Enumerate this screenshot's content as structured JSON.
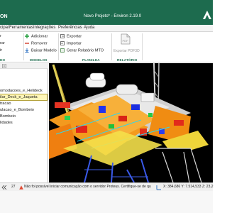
{
  "window": {
    "app_label": "ON",
    "title": "Novo Projeto* - Environ 2.19.0",
    "partial_title": "- Environ 2.19.0"
  },
  "menu": [
    "cipal",
    "Ferramentas",
    "Integrações",
    "Preferências",
    "Ajuda"
  ],
  "ribbon": {
    "modelos_buttons": [
      "Adicionar",
      "Remover",
      "Baixar Modelo"
    ],
    "planilha_buttons": [
      "Exportar",
      "Importar",
      "Gerar Relatório MTO"
    ],
    "relatorio_button": "Exportar PDF3D",
    "left_buttons": [
      "r",
      "rar",
      "ir"
    ],
    "groups": [
      "DO",
      "MODELOS",
      "PLANILHA",
      "RELATÓRIO"
    ]
  },
  "tree": {
    "items": [
      "omodacoes_e_Helideck",
      "ilar_Deck_e_Jaqueta",
      "tracao",
      "ulacao_e_Bombeio",
      "Bombeio",
      "lidades"
    ],
    "selected": 1
  },
  "status": {
    "page": "27",
    "message": "Não foi possível iniciar comunicação com o servidor Proteus. Certifique-se de qu",
    "coords": "X: 384,686  Y: 7.514,533  Z: 23,2"
  },
  "colors": {
    "brand": "#1d6b4e",
    "selection": "#fff6b8"
  }
}
